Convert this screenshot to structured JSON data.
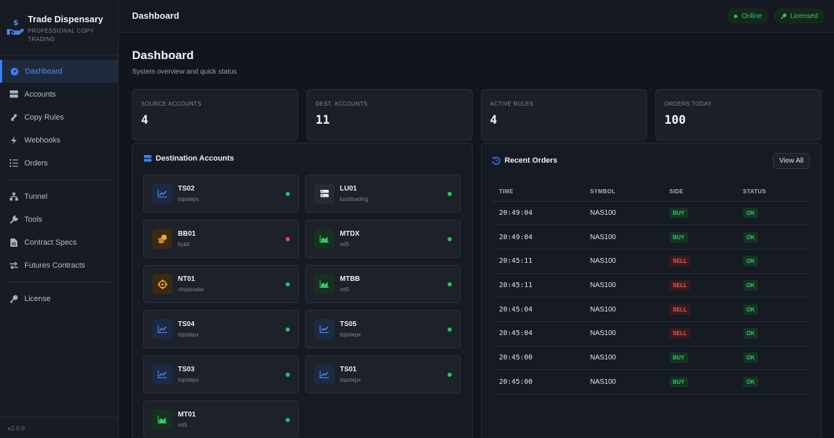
{
  "brand": {
    "title": "Trade Dispensary",
    "subtitle_line1": "PROFESSIONAL COPY",
    "subtitle_line2": "TRADING"
  },
  "sidebar": {
    "items": [
      {
        "label": "Dashboard",
        "icon": "gauge-icon",
        "active": true
      },
      {
        "label": "Accounts",
        "icon": "server-icon"
      },
      {
        "label": "Copy Rules",
        "icon": "arrows-icon"
      },
      {
        "label": "Webhooks",
        "icon": "bolt-icon"
      },
      {
        "label": "Orders",
        "icon": "list-icon"
      },
      {
        "label": "Tunnel",
        "icon": "network-icon"
      },
      {
        "label": "Tools",
        "icon": "wrench-icon"
      },
      {
        "label": "Contract Specs",
        "icon": "document-icon"
      },
      {
        "label": "Futures Contracts",
        "icon": "exchange-icon"
      },
      {
        "label": "License",
        "icon": "key-icon"
      }
    ],
    "version": "v2.0.0"
  },
  "topbar": {
    "title": "Dashboard",
    "status_online": "Online",
    "status_licensed": "Licensed"
  },
  "page": {
    "title": "Dashboard",
    "subtitle": "System overview and quick status"
  },
  "stats": [
    {
      "label": "SOURCE ACCOUNTS",
      "value": "4"
    },
    {
      "label": "DEST. ACCOUNTS",
      "value": "11"
    },
    {
      "label": "ACTIVE RULES",
      "value": "4"
    },
    {
      "label": "ORDERS TODAY",
      "value": "100"
    }
  ],
  "destinations": {
    "title": "Destination Accounts",
    "accounts": [
      {
        "name": "TS02",
        "platform": "topstepx",
        "icon": "chart-line-icon",
        "status": "online"
      },
      {
        "name": "LU01",
        "platform": "lucidtrading",
        "icon": "server-icon",
        "status": "online"
      },
      {
        "name": "BB01",
        "platform": "bybit",
        "icon": "coins-icon",
        "status": "offline"
      },
      {
        "name": "MTDX",
        "platform": "mt5",
        "icon": "chart-area-icon",
        "status": "online"
      },
      {
        "name": "NT01",
        "platform": "ninjatrader",
        "icon": "crosshair-icon",
        "status": "online"
      },
      {
        "name": "MTBB",
        "platform": "mt5",
        "icon": "chart-area-icon",
        "status": "online"
      },
      {
        "name": "TS04",
        "platform": "topstepx",
        "icon": "chart-line-icon",
        "status": "online"
      },
      {
        "name": "TS05",
        "platform": "topstepx",
        "icon": "chart-line-icon",
        "status": "online"
      },
      {
        "name": "TS03",
        "platform": "topstepx",
        "icon": "chart-line-icon",
        "status": "online"
      },
      {
        "name": "TS01",
        "platform": "topstepx",
        "icon": "chart-line-icon",
        "status": "online"
      },
      {
        "name": "MT01",
        "platform": "mt5",
        "icon": "chart-area-icon",
        "status": "online"
      }
    ]
  },
  "orders": {
    "title": "Recent Orders",
    "view_all": "View All",
    "columns": [
      "TIME",
      "SYMBOL",
      "SIDE",
      "STATUS"
    ],
    "rows": [
      {
        "time": "20:49:04",
        "symbol": "NAS100",
        "side": "BUY",
        "status": "OK"
      },
      {
        "time": "20:49:04",
        "symbol": "NAS100",
        "side": "BUY",
        "status": "OK"
      },
      {
        "time": "20:45:11",
        "symbol": "NAS100",
        "side": "SELL",
        "status": "OK"
      },
      {
        "time": "20:45:11",
        "symbol": "NAS100",
        "side": "SELL",
        "status": "OK"
      },
      {
        "time": "20:45:04",
        "symbol": "NAS100",
        "side": "SELL",
        "status": "OK"
      },
      {
        "time": "20:45:04",
        "symbol": "NAS100",
        "side": "SELL",
        "status": "OK"
      },
      {
        "time": "20:45:00",
        "symbol": "NAS100",
        "side": "BUY",
        "status": "OK"
      },
      {
        "time": "20:45:00",
        "symbol": "NAS100",
        "side": "BUY",
        "status": "OK"
      }
    ]
  },
  "colors": {
    "accent": "#3b82f6",
    "online": "#22c55e",
    "offline": "#ef4444"
  }
}
